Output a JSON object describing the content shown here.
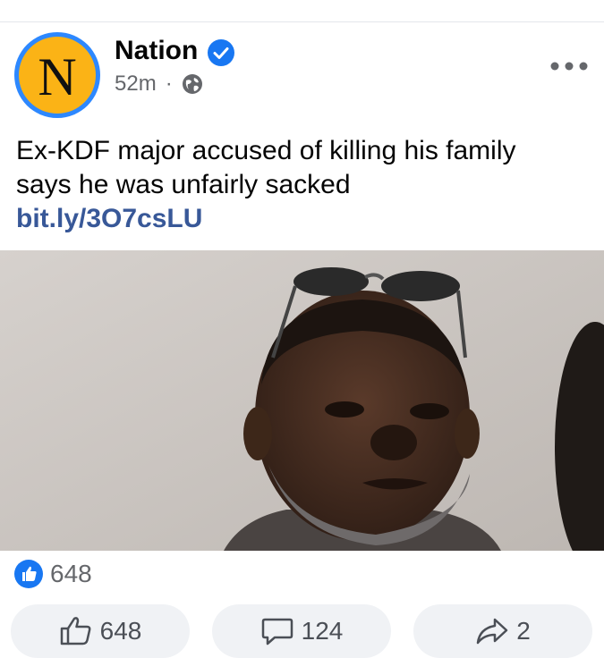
{
  "post": {
    "page_name": "Nation",
    "avatar_letter": "N",
    "time": "52m",
    "separator": "·",
    "visibility_icon": "globe-icon",
    "verified_icon": "verified-badge-icon",
    "more_icon": "more-options-icon",
    "caption_line1": "Ex-KDF major accused of killing his family",
    "caption_line2": "says he was unfairly sacked",
    "link": "bit.ly/3O7csLU"
  },
  "reactions": {
    "icon": "like-reaction-icon",
    "count": "648"
  },
  "actions": {
    "like_count": "648",
    "comment_count": "124",
    "share_count": "2"
  },
  "colors": {
    "accent": "#1877f2",
    "avatar_ring": "#2d88ff",
    "avatar_fill": "#fbb316",
    "link": "#385898",
    "button_bg": "#f0f2f5",
    "secondary_text": "#65676b"
  }
}
